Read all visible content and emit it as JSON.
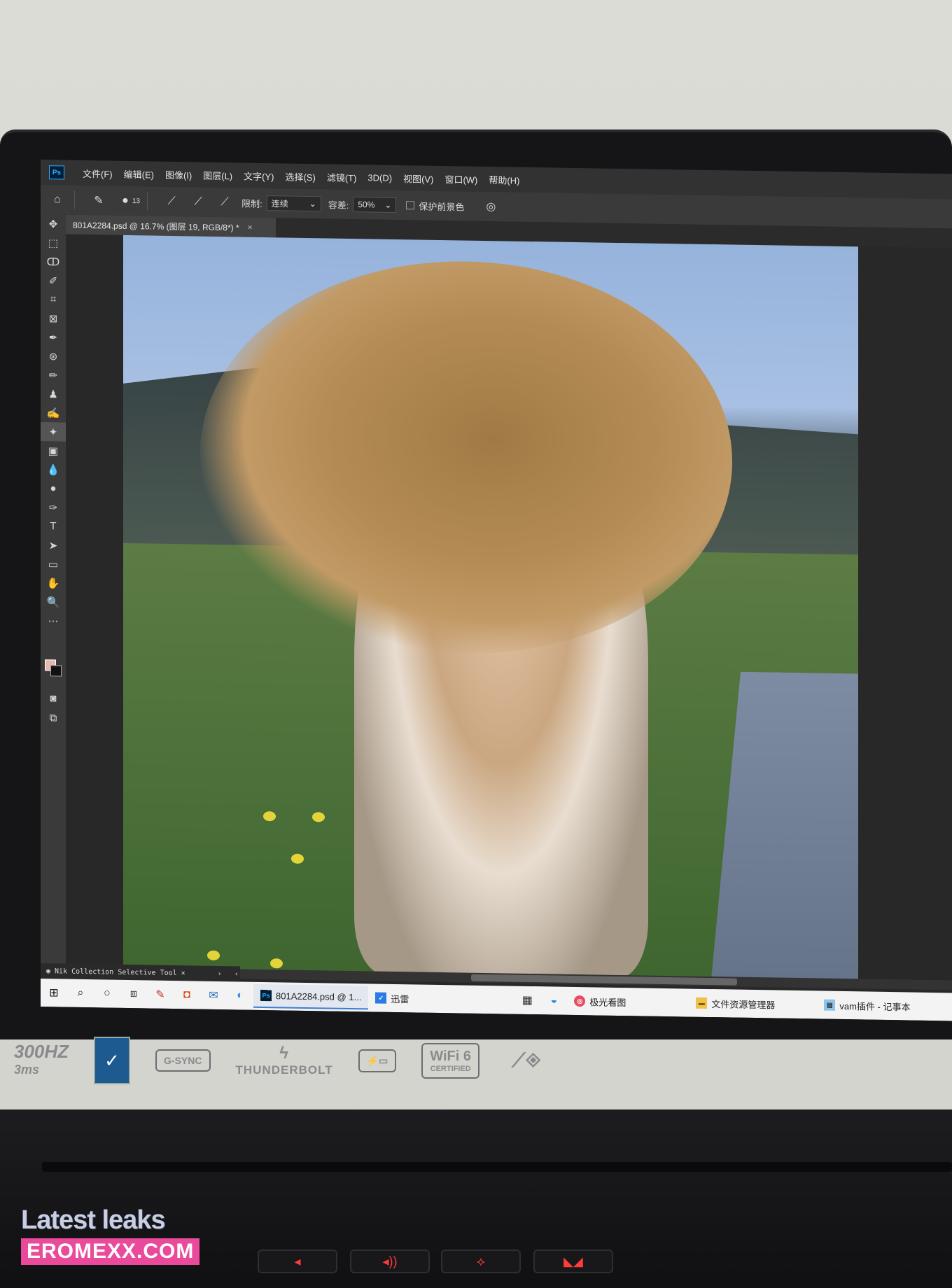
{
  "photoshop": {
    "logo": "Ps",
    "menu": [
      "文件(F)",
      "编辑(E)",
      "图像(I)",
      "图层(L)",
      "文字(Y)",
      "选择(S)",
      "滤镜(T)",
      "3D(D)",
      "视图(V)",
      "窗口(W)",
      "帮助(H)"
    ],
    "options": {
      "brush_size": "13",
      "limit_label": "限制:",
      "limit_value": "连续",
      "tolerance_label": "容差:",
      "tolerance_value": "50%",
      "protect_label": "保护前景色"
    },
    "doc_tab": {
      "title": "801A2284.psd @ 16.7% (图层 19, RGB/8*) *",
      "close": "×"
    },
    "nik_panel": {
      "title": "Nik Collection Selective Tool",
      "close": "×",
      "arrow": "›",
      "back": "‹"
    },
    "colors": {
      "foreground": "#e7b8ad",
      "background": "#111111"
    }
  },
  "taskbar": {
    "apps": [
      {
        "label": "801A2284.psd @ 1...",
        "icon": "photoshop-icon"
      },
      {
        "label": "迅雷",
        "icon": "xunlei-icon"
      },
      {
        "label": "极光看图",
        "icon": "image-viewer-icon"
      },
      {
        "label": "文件资源管理器",
        "icon": "folder-icon"
      },
      {
        "label": "vam插件 - 记事本",
        "icon": "notepad-icon"
      }
    ]
  },
  "chassis": {
    "refresh_rate": "300HZ",
    "response_time": "3ms",
    "gsync": "G-SYNC",
    "thunderbolt": "THUNDERBOLT",
    "wifi": "WiFi 6",
    "wifi_cert": "CERTIFIED"
  },
  "watermark": {
    "title": "Latest leaks",
    "site": "EROMEXX.COM"
  }
}
